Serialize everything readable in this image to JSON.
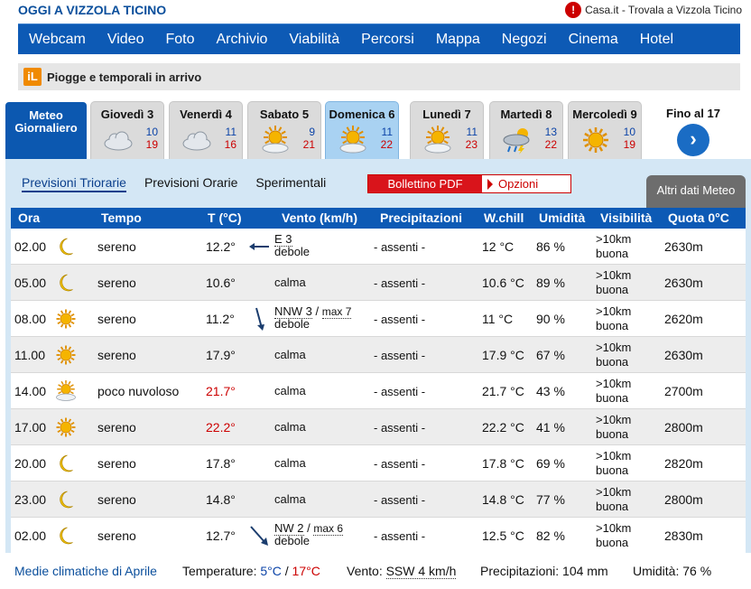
{
  "header": {
    "site_title": "OGGI A VIZZOLA TICINO",
    "casa_text": "Casa.it - Trovala a Vizzola Ticino"
  },
  "nav": [
    "Webcam",
    "Video",
    "Foto",
    "Archivio",
    "Viabilità",
    "Percorsi",
    "Mappa",
    "Negozi",
    "Cinema",
    "Hotel"
  ],
  "alert": {
    "text": "Piogge e temporali in arrivo"
  },
  "day_tabs": {
    "main_line1": "Meteo",
    "main_line2": "Giornaliero",
    "days": [
      {
        "name": "Giovedì 3",
        "min": "10",
        "max": "19",
        "icon": "cloud-icon"
      },
      {
        "name": "Venerdì 4",
        "min": "11",
        "max": "16",
        "icon": "cloud-icon"
      },
      {
        "name": "Sabato 5",
        "min": "9",
        "max": "21",
        "icon": "sun-cloud-icon"
      },
      {
        "name": "Domenica 6",
        "min": "11",
        "max": "22",
        "icon": "sun-cloud-icon"
      },
      {
        "name": "Lunedì 7",
        "min": "11",
        "max": "23",
        "icon": "sun-cloud-icon"
      },
      {
        "name": "Martedì 8",
        "min": "13",
        "max": "22",
        "icon": "storm-icon"
      },
      {
        "name": "Mercoledì 9",
        "min": "10",
        "max": "19",
        "icon": "sun-icon"
      }
    ],
    "fino": "Fino al 17"
  },
  "subtabs": [
    "Previsioni Triorarie",
    "Previsioni Orarie",
    "Sperimentali"
  ],
  "pdf_label": "Bollettino PDF",
  "options_label": "Opzioni",
  "altri_label": "Altri dati Meteo",
  "table": {
    "headers": [
      "Ora",
      "Tempo",
      "T (°C)",
      "Vento (km/h)",
      "Precipitazioni",
      "W.chill",
      "Umidità",
      "Visibilità",
      "Quota 0°C"
    ],
    "rows": [
      {
        "ora": "02.00",
        "icon": "moon-icon",
        "tempo": "sereno",
        "t": "12.2°",
        "hot": false,
        "vento_dir": "E 3",
        "vento_max": "",
        "vento_desc": "debole",
        "arrow": "left",
        "prec": "- assenti -",
        "wchill": "12 °C",
        "umid": "86 %",
        "vis1": ">10km",
        "vis2": "buona",
        "quota": "2630m"
      },
      {
        "ora": "05.00",
        "icon": "moon-icon",
        "tempo": "sereno",
        "t": "10.6°",
        "hot": false,
        "vento_dir": "calma",
        "vento_max": "",
        "vento_desc": "",
        "arrow": "",
        "prec": "- assenti -",
        "wchill": "10.6 °C",
        "umid": "89 %",
        "vis1": ">10km",
        "vis2": "buona",
        "quota": "2630m"
      },
      {
        "ora": "08.00",
        "icon": "sun-icon",
        "tempo": "sereno",
        "t": "11.2°",
        "hot": false,
        "vento_dir": "NNW 3",
        "vento_max": "max 7",
        "vento_desc": "debole",
        "arrow": "down",
        "prec": "- assenti -",
        "wchill": "11 °C",
        "umid": "90 %",
        "vis1": ">10km",
        "vis2": "buona",
        "quota": "2620m"
      },
      {
        "ora": "11.00",
        "icon": "sun-icon",
        "tempo": "sereno",
        "t": "17.9°",
        "hot": false,
        "vento_dir": "calma",
        "vento_max": "",
        "vento_desc": "",
        "arrow": "",
        "prec": "- assenti -",
        "wchill": "17.9 °C",
        "umid": "67 %",
        "vis1": ">10km",
        "vis2": "buona",
        "quota": "2630m"
      },
      {
        "ora": "14.00",
        "icon": "sun-cloud-icon",
        "tempo": "poco nuvoloso",
        "t": "21.7°",
        "hot": true,
        "vento_dir": "calma",
        "vento_max": "",
        "vento_desc": "",
        "arrow": "",
        "prec": "- assenti -",
        "wchill": "21.7 °C",
        "umid": "43 %",
        "vis1": ">10km",
        "vis2": "buona",
        "quota": "2700m"
      },
      {
        "ora": "17.00",
        "icon": "sun-icon",
        "tempo": "sereno",
        "t": "22.2°",
        "hot": true,
        "vento_dir": "calma",
        "vento_max": "",
        "vento_desc": "",
        "arrow": "",
        "prec": "- assenti -",
        "wchill": "22.2 °C",
        "umid": "41 %",
        "vis1": ">10km",
        "vis2": "buona",
        "quota": "2800m"
      },
      {
        "ora": "20.00",
        "icon": "moon-icon",
        "tempo": "sereno",
        "t": "17.8°",
        "hot": false,
        "vento_dir": "calma",
        "vento_max": "",
        "vento_desc": "",
        "arrow": "",
        "prec": "- assenti -",
        "wchill": "17.8 °C",
        "umid": "69 %",
        "vis1": ">10km",
        "vis2": "buona",
        "quota": "2820m"
      },
      {
        "ora": "23.00",
        "icon": "moon-icon",
        "tempo": "sereno",
        "t": "14.8°",
        "hot": false,
        "vento_dir": "calma",
        "vento_max": "",
        "vento_desc": "",
        "arrow": "",
        "prec": "- assenti -",
        "wchill": "14.8 °C",
        "umid": "77 %",
        "vis1": ">10km",
        "vis2": "buona",
        "quota": "2800m"
      },
      {
        "ora": "02.00",
        "icon": "moon-icon",
        "tempo": "sereno",
        "t": "12.7°",
        "hot": false,
        "vento_dir": "NW 2",
        "vento_max": "max 6",
        "vento_desc": "debole",
        "arrow": "downright",
        "prec": "- assenti -",
        "wchill": "12.5 °C",
        "umid": "82 %",
        "vis1": ">10km",
        "vis2": "buona",
        "quota": "2830m"
      }
    ]
  },
  "footer": {
    "medie": "Medie climatiche di Aprile",
    "temp_label": "Temperature:",
    "temp_min": "5°C",
    "sep": "/",
    "temp_max": "17°C",
    "vento_label": "Vento:",
    "vento_val": "SSW 4 km/h",
    "prec_label": "Precipitazioni:",
    "prec_val": "104 mm",
    "umid_label": "Umidità:",
    "umid_val": "76 %"
  },
  "colors": {
    "nav_blue": "#0d5ab5",
    "min_blue": "#0c44a8",
    "max_red": "#cc0000",
    "panel_bg": "#d4e7f5"
  }
}
